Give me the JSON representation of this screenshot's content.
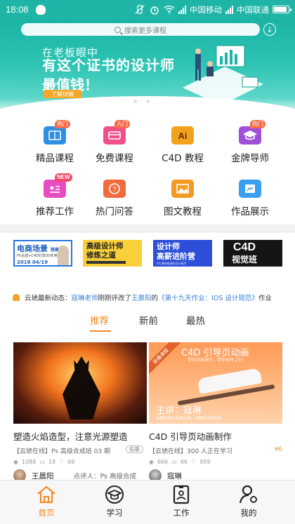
{
  "status_bar": {
    "time": "18:08",
    "carrier1": "中国移动",
    "carrier2": "中国联通"
  },
  "search": {
    "placeholder": "搜索更多课程"
  },
  "banner": {
    "subtitle": "在老板眼中",
    "title_line1": "有这个证书的设计师",
    "title_line2": "最值钱！",
    "button": "了解详情",
    "dot_count": 3,
    "active_dot": 1
  },
  "categories": [
    {
      "label": "精品课程",
      "badge": "热门",
      "icon": "book-icon",
      "color": "#2f8fe0"
    },
    {
      "label": "免费课程",
      "badge": "入门",
      "icon": "card-icon",
      "color": "#f0508a"
    },
    {
      "label": "C4D 教程",
      "badge": "",
      "icon": "ai-icon",
      "color": "#f2a21c"
    },
    {
      "label": "金牌导师",
      "badge": "热门",
      "icon": "graduation-cap-icon",
      "color": "#a04fd8"
    },
    {
      "label": "推荐工作",
      "badge": "NEW",
      "icon": "id-card-icon",
      "color": "#e84cc2"
    },
    {
      "label": "热门问答",
      "badge": "",
      "icon": "question-icon",
      "color": "#f06a3c"
    },
    {
      "label": "图文教程",
      "badge": "",
      "icon": "image-icon",
      "color": "#f49a22"
    },
    {
      "label": "作品展示",
      "badge": "",
      "icon": "folder-icon",
      "color": "#3a9ff0"
    }
  ],
  "thumbs": {
    "t1": {
      "title": "电商场景",
      "tag": "搭建",
      "sub": "PS合成+C4D打造3D化电商场景",
      "date": "2018 04/19"
    },
    "t2": {
      "line1": "高级设计师",
      "line2": "修炼之道"
    },
    "t3": {
      "line1": "设计师",
      "line2": "高薪进阶营",
      "sub": "4大课系统进阶设计高手"
    },
    "t4": {
      "line1": "C4D",
      "line2": "视觉班"
    }
  },
  "ticker": {
    "prefix": "云琥最新动态：",
    "name1": "寇琳老师",
    "mid": "刚刚评改了",
    "name2": "王晨阳",
    "pre_title": "的",
    "title": "《第十九天作业：IOS 设计规范》",
    "suffix": "作业"
  },
  "tabs": [
    {
      "label": "推荐",
      "active": true
    },
    {
      "label": "新前",
      "active": false
    },
    {
      "label": "最热",
      "active": false
    }
  ],
  "cards": [
    {
      "title": "塑造火焰造型，注意光源塑造",
      "meta": "【云琥在线】Ps 高级合成班 03 期",
      "tag": "临摹",
      "price": "",
      "views": "1088",
      "comments": "18",
      "likes": "66",
      "author": "王晨阳",
      "comment": "点评人：Ps 高级合成",
      "image": {
        "ribbon": "",
        "heading": "",
        "sub": "",
        "host": "",
        "note": ""
      }
    },
    {
      "title": "C4D 引导页动画制作",
      "meta": "【云琥在线】300 人正在学习",
      "tag": "",
      "price": "¥6",
      "views": "666",
      "comments": "66",
      "likes": "999",
      "author": "寇琳",
      "comment": "",
      "image": {
        "ribbon": "录播课程",
        "heading": "C4D 引导页动画",
        "sub": "带你动画操作，带你玩转 250",
        "host": "主讲：寇琳",
        "note": "本图来源于云琥在线，转载请注明出处"
      }
    }
  ],
  "bottom_nav": [
    {
      "label": "首页",
      "icon": "home-icon",
      "active": true
    },
    {
      "label": "学习",
      "icon": "graduation-cap-icon",
      "active": false
    },
    {
      "label": "工作",
      "icon": "id-badge-icon",
      "active": false
    },
    {
      "label": "我的",
      "icon": "user-icon",
      "active": false
    }
  ],
  "colors": {
    "accent": "#f08c2a",
    "teal": "#1fb5a6",
    "link": "#3a7fd5"
  }
}
